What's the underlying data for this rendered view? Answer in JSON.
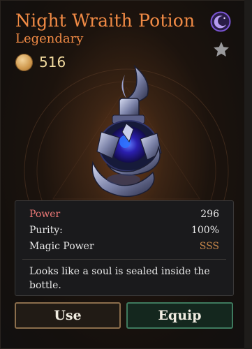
{
  "item": {
    "name": "Night Wraith Potion",
    "rarity": "Legendary",
    "price": "516"
  },
  "stats": [
    {
      "label": "Power",
      "value": "296"
    },
    {
      "label": "Purity:",
      "value": "100%"
    },
    {
      "label": "Magic Power",
      "value": "SSS"
    }
  ],
  "description": "Looks like a soul is sealed inside the bottle.",
  "actions": {
    "use_label": "Use",
    "equip_label": "Equip"
  },
  "icons": {
    "type_badge": "crescent-moon-icon",
    "favorite": "star-icon",
    "currency": "gold-coin-icon"
  },
  "colors": {
    "title": "#f08a45",
    "power_label": "#f07a78",
    "grade_value": "#c7874a",
    "use_border": "#8b6e4c",
    "equip_border": "#3e7a5e",
    "moon_badge": "#7b55d6"
  }
}
